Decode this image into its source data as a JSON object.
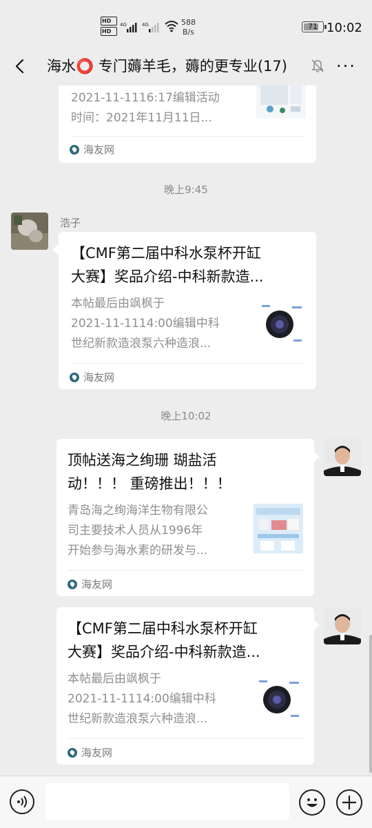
{
  "status_bar": {
    "hd_labels": [
      "HD",
      "HD"
    ],
    "network_labels": [
      "4G",
      "4G"
    ],
    "speed_value": "588",
    "speed_unit": "B/s",
    "battery": "71",
    "time": "10:02"
  },
  "header": {
    "title": "海水⭕ 专门薅羊毛，薅的更专业(17)",
    "back_icon": "chevron-left-icon",
    "mute_icon": "bell-off-icon",
    "more_icon": "more-dots-icon",
    "more_label": "···"
  },
  "messages": [
    {
      "type": "card",
      "side": "left",
      "partial": true,
      "desc_lines": [
        "2021-11-1116:17编辑活动",
        "时间：2021年11月11日..."
      ],
      "source": "海友网"
    },
    {
      "type": "time",
      "text": "晚上9:45"
    },
    {
      "type": "card",
      "side": "left",
      "sender": "浩子",
      "title_lines": [
        "【CMF第二届中科水泵杯开缸",
        "大赛】奖品介绍-中科新款造..."
      ],
      "desc_lines": [
        "本帖最后由飒枫于",
        "2021-11-1114:00编辑中科",
        "世纪新款造浪泵六种造浪..."
      ],
      "source": "海友网"
    },
    {
      "type": "time",
      "text": "晚上10:02"
    },
    {
      "type": "card",
      "side": "right",
      "title_lines": [
        "顶帖送海之绚珊 瑚盐活",
        "动！！！ 重磅推出！！！"
      ],
      "desc_lines": [
        "青岛海之绚海洋生物有限公",
        "司主要技术人员从1996年",
        "开始参与海水素的研发与..."
      ],
      "source": "海友网"
    },
    {
      "type": "card",
      "side": "right",
      "title_lines": [
        "【CMF第二届中科水泵杯开缸",
        "大赛】奖品介绍-中科新款造..."
      ],
      "desc_lines": [
        "本帖最后由飒枫于",
        "2021-11-1114:00编辑中科",
        "世纪新款造浪泵六种造浪..."
      ],
      "source": "海友网"
    }
  ],
  "input_bar": {
    "voice_icon": "voice-icon",
    "emoji_icon": "emoji-icon",
    "plus_icon": "plus-icon",
    "input_value": ""
  },
  "colors": {
    "background": "#ededed",
    "card": "#ffffff",
    "muted_text": "#8f8f8f",
    "source_icon": "#2e6a7a"
  }
}
